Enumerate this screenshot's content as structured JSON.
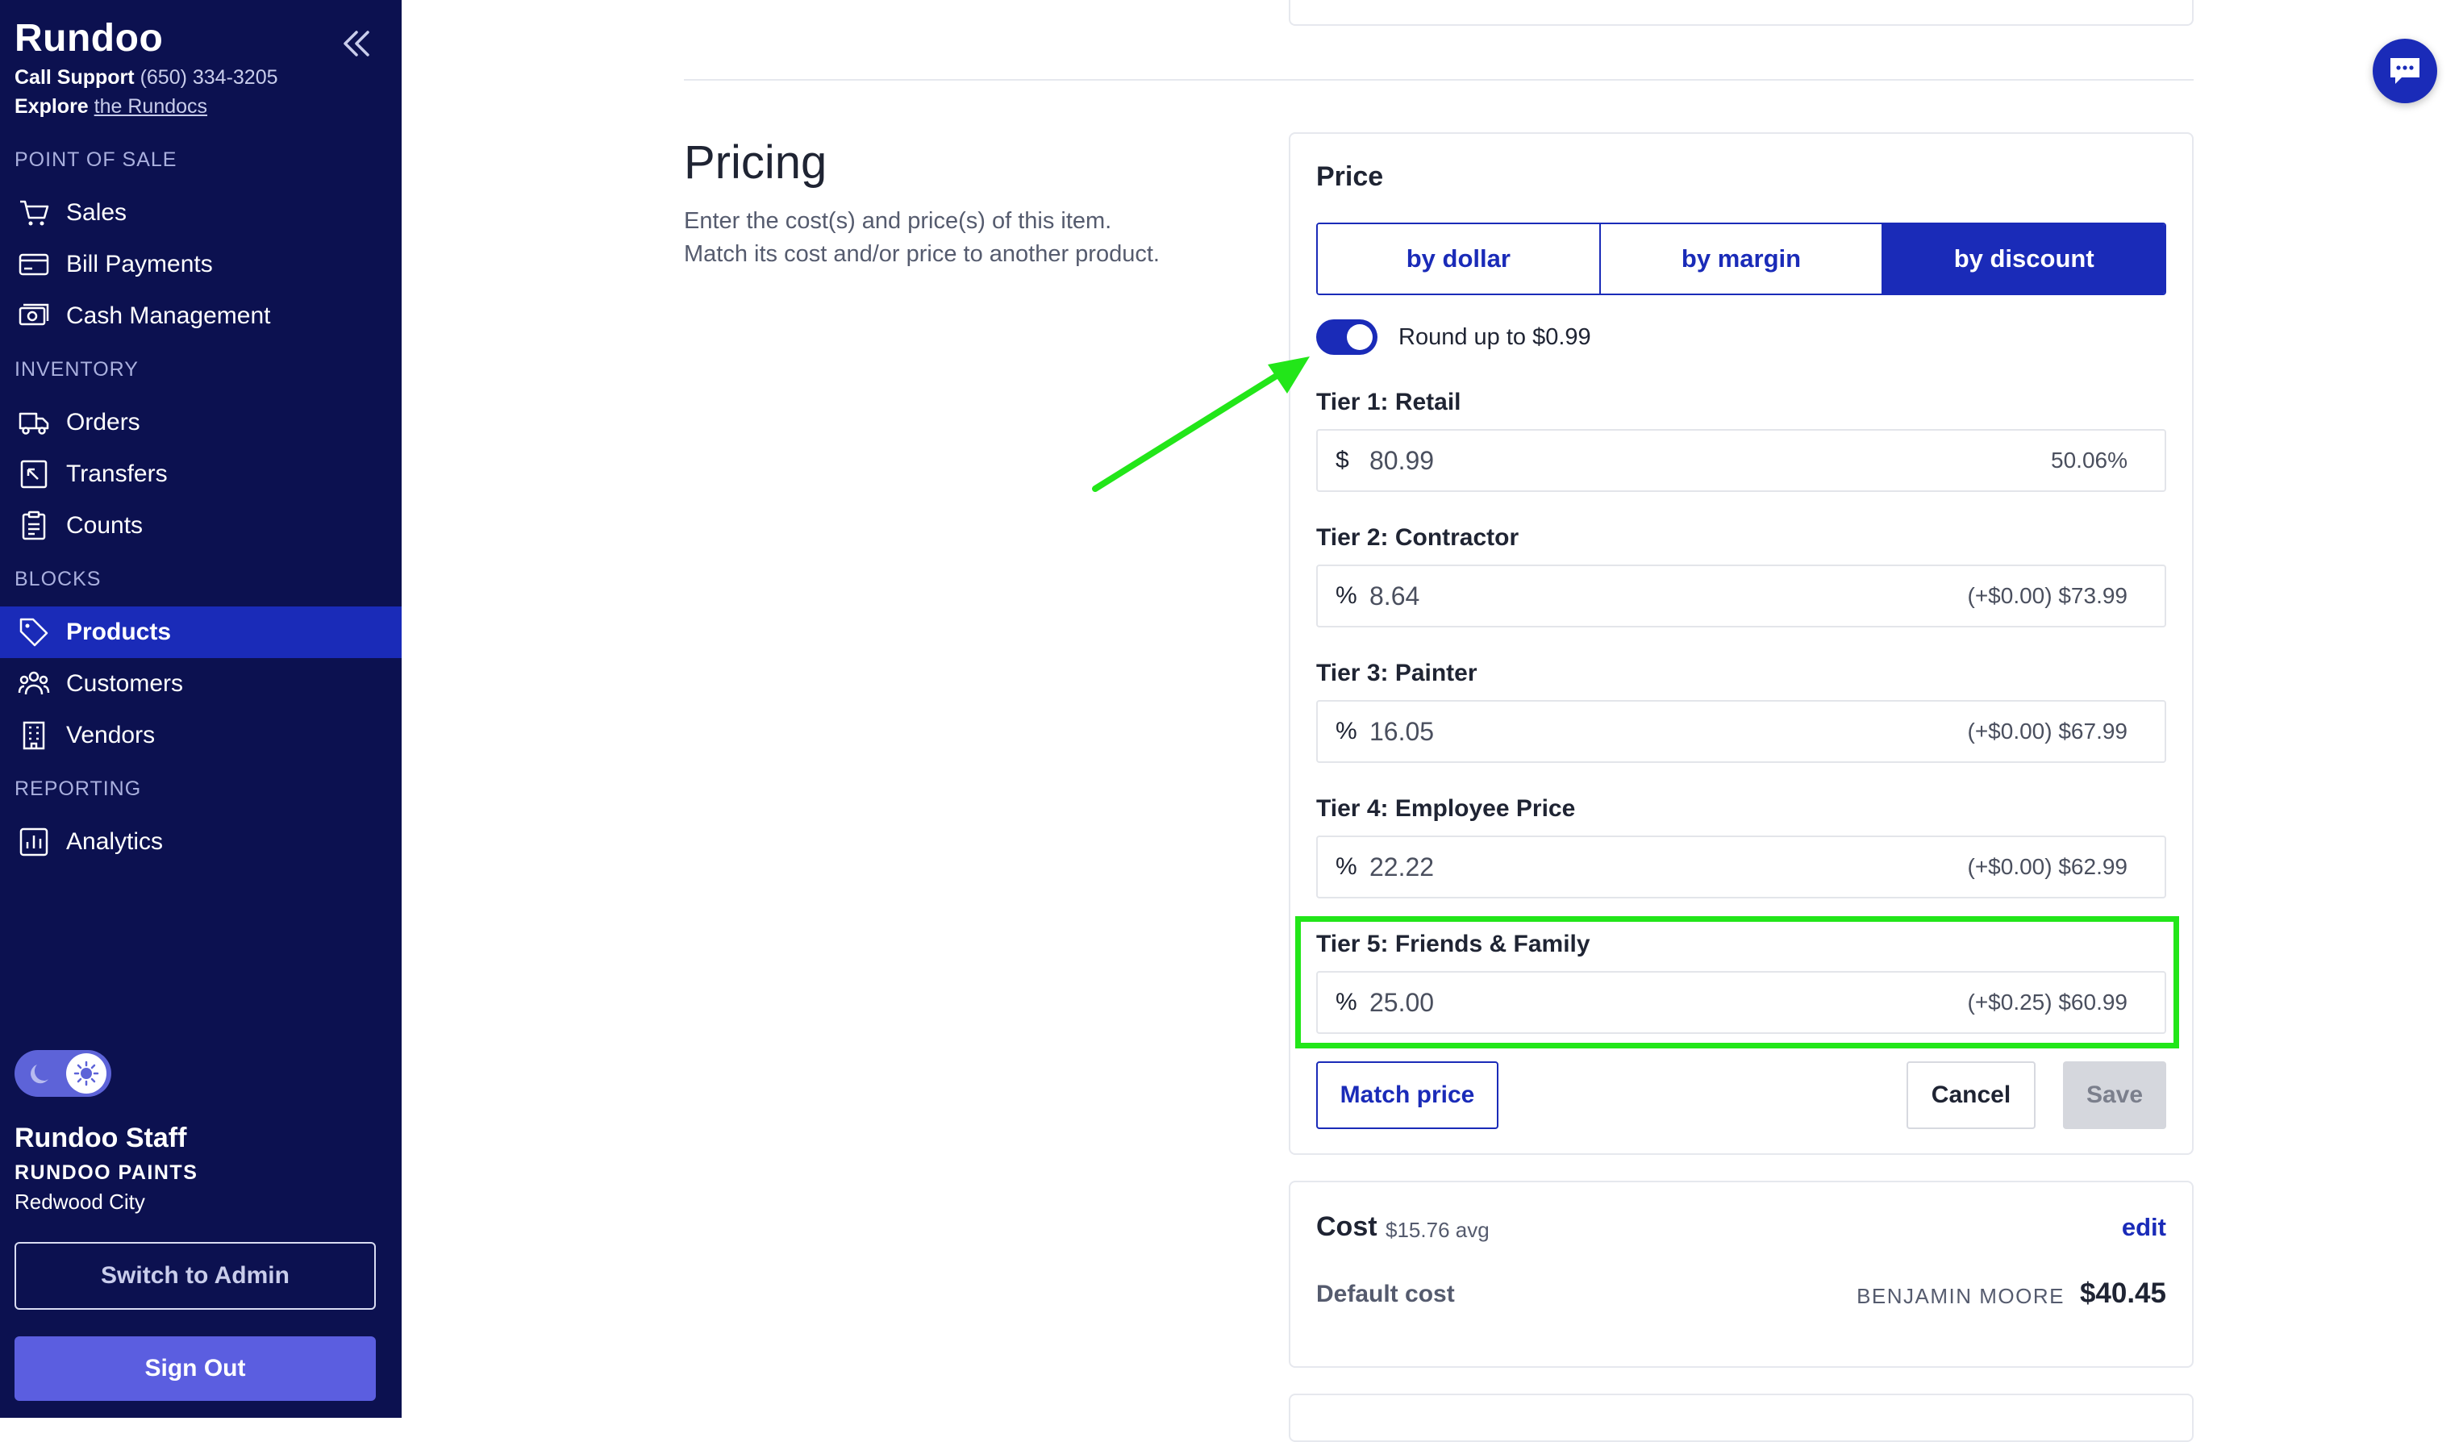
{
  "sidebar": {
    "brand": "Rundoo",
    "support_label": "Call Support",
    "support_phone": "(650) 334-3205",
    "explore_label": "Explore",
    "explore_link": "the Rundocs",
    "sections": [
      "POINT OF SALE",
      "INVENTORY",
      "BLOCKS",
      "REPORTING"
    ],
    "items": [
      {
        "label": "Sales",
        "icon": "cart-icon"
      },
      {
        "label": "Bill Payments",
        "icon": "card-icon"
      },
      {
        "label": "Cash Management",
        "icon": "cash-icon"
      },
      {
        "label": "Orders",
        "icon": "truck-icon"
      },
      {
        "label": "Transfers",
        "icon": "transfer-icon"
      },
      {
        "label": "Counts",
        "icon": "clipboard-icon"
      },
      {
        "label": "Products",
        "icon": "tag-icon",
        "active": true
      },
      {
        "label": "Customers",
        "icon": "users-icon"
      },
      {
        "label": "Vendors",
        "icon": "building-icon"
      },
      {
        "label": "Analytics",
        "icon": "chart-icon"
      }
    ],
    "user_name": "Rundoo Staff",
    "store_name": "RUNDOO PAINTS",
    "city": "Redwood City",
    "switch_admin": "Switch to Admin",
    "sign_out": "Sign Out"
  },
  "pricing": {
    "title": "Pricing",
    "desc_line1": "Enter the cost(s) and price(s) of this item.",
    "desc_line2": "Match its cost and/or price to another product."
  },
  "price_card": {
    "title": "Price",
    "modes": [
      "by dollar",
      "by margin",
      "by discount"
    ],
    "selected_mode": "by discount",
    "round_label": "Round up to $0.99",
    "round_enabled": true,
    "tiers": [
      {
        "label": "Tier 1: Retail",
        "unit": "$",
        "value": "80.99",
        "hint": "50.06%"
      },
      {
        "label": "Tier 2: Contractor",
        "unit": "%",
        "value": "8.64",
        "hint": "(+$0.00) $73.99"
      },
      {
        "label": "Tier 3: Painter",
        "unit": "%",
        "value": "16.05",
        "hint": "(+$0.00) $67.99"
      },
      {
        "label": "Tier 4: Employee Price",
        "unit": "%",
        "value": "22.22",
        "hint": "(+$0.00) $62.99"
      },
      {
        "label": "Tier 5: Friends & Family",
        "unit": "%",
        "value": "25.00",
        "hint": "(+$0.25) $60.99"
      }
    ],
    "match_price": "Match price",
    "cancel": "Cancel",
    "save": "Save"
  },
  "cost_card": {
    "title": "Cost",
    "avg": "$15.76 avg",
    "edit": "edit",
    "default_label": "Default cost",
    "vendor": "BENJAMIN MOORE",
    "amount": "$40.45"
  },
  "colors": {
    "sidebar_bg": "#0c1150",
    "accent": "#1a2bb8",
    "highlight": "#22e619"
  }
}
